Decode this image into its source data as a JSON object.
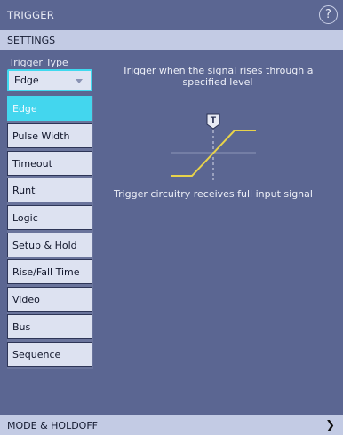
{
  "header": {
    "title": "TRIGGER",
    "help_icon": "?"
  },
  "settings": {
    "title": "SETTINGS"
  },
  "trigger_type": {
    "label": "Trigger Type",
    "selected": "Edge",
    "options": [
      "Edge",
      "Pulse Width",
      "Timeout",
      "Runt",
      "Logic",
      "Setup & Hold",
      "Rise/Fall Time",
      "Video",
      "Bus",
      "Sequence"
    ]
  },
  "description": {
    "line1": "Trigger when the signal rises through a",
    "line2": "specified level",
    "trigger_marker": "T",
    "note": "Trigger circuitry receives full input signal"
  },
  "mode_holdoff": {
    "title": "MODE & HOLDOFF",
    "chevron": "❯"
  },
  "colors": {
    "accent": "#43d6ee",
    "signal": "#e8d34a",
    "panel": "#5b6692"
  }
}
